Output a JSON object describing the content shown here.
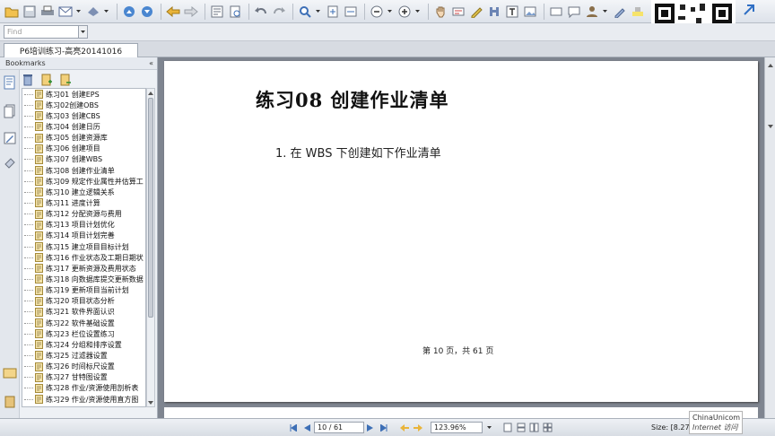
{
  "find": {
    "placeholder": "Find"
  },
  "tab": {
    "label": "P6培训练习-高亮20141016"
  },
  "bookmarks": {
    "title": "Bookmarks",
    "items": [
      "练习01 创建EPS",
      "练习02创建OBS",
      "练习03 创建CBS",
      "练习04 创建日历",
      "练习05 创建资源库",
      "练习06 创建项目",
      "练习07 创建WBS",
      "练习08 创建作业清单",
      "练习09 规定作业属性并估算工",
      "练习10 建立逻辑关系",
      "练习11 进度计算",
      "练习12 分配资源与费用",
      "练习13 项目计划优化",
      "练习14 项目计划完善",
      "练习15 建立项目目标计划",
      "练习16 作业状态及工期日期状",
      "练习17 更新资源及费用状态",
      "练习18 向数据库提交更新数据",
      "练习19 更新项目当前计划",
      "练习20 项目状态分析",
      "练习21 软件界面认识",
      "练习22 软件基础设置",
      "练习23 栏位设置练习",
      "练习24 分组和排序设置",
      "练习25 过滤器设置",
      "练习26 时间标尺设置",
      "练习27 甘特图设置",
      "练习28 作业/资源使用剖析表",
      "练习29 作业/资源使用直方图"
    ]
  },
  "document": {
    "title": "练习08   创建作业清单",
    "item": "1. 在 WBS 下创建如下作业清单",
    "footer": "第  10 页，共   61 页"
  },
  "status": {
    "page": "10 / 61",
    "zoom": "123.96%",
    "size": "Size: [8.27"
  },
  "overlay": {
    "brand": "ChinaUnicom",
    "sub": "Internet 访问"
  },
  "colors": {
    "accent": "#2f6fc4",
    "doc_bg": "#7f8590"
  }
}
